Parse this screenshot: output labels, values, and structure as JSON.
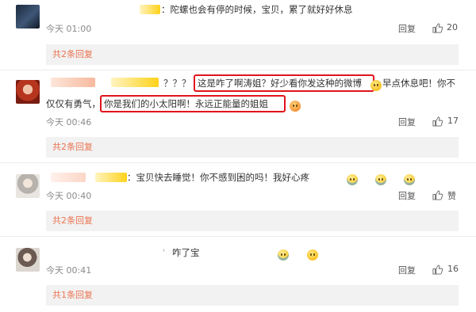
{
  "comments": [
    {
      "text": "：陀螺也会有停的时候，宝贝，累了就好好休息",
      "time": "今天 01:00",
      "reply_label": "回复",
      "like_count": "20",
      "sub_replies": "共2条回复"
    },
    {
      "text_prefix": "？？？",
      "text_highlight1": "这是咋了啊涛姐？好少看你发这种的微博",
      "text_after1": "早点休息吧！你不",
      "text_line2_prefix": "仅仅有勇气，",
      "text_highlight2": "你是我们的小太阳啊！永远正能量的姐姐",
      "time": "今天 00:46",
      "reply_label": "回复",
      "like_count": "17",
      "sub_replies": "共2条回复"
    },
    {
      "text": "：宝贝快去睡觉！你不感到困的吗！我好心疼",
      "time": "今天 00:40",
      "reply_label": "回复",
      "like_count": "赞",
      "sub_replies": "共2条回复"
    },
    {
      "text": "咋了宝",
      "time": "今天 00:41",
      "reply_label": "回复",
      "like_count": "16",
      "sub_replies": "共1条回复"
    }
  ],
  "icons": {
    "like": "thumbs-up-icon",
    "emoji": "emoji-icon"
  },
  "colors": {
    "highlight_border": "#e0141c",
    "sub_link": "#eb7350",
    "meta": "#8a8a8a"
  }
}
